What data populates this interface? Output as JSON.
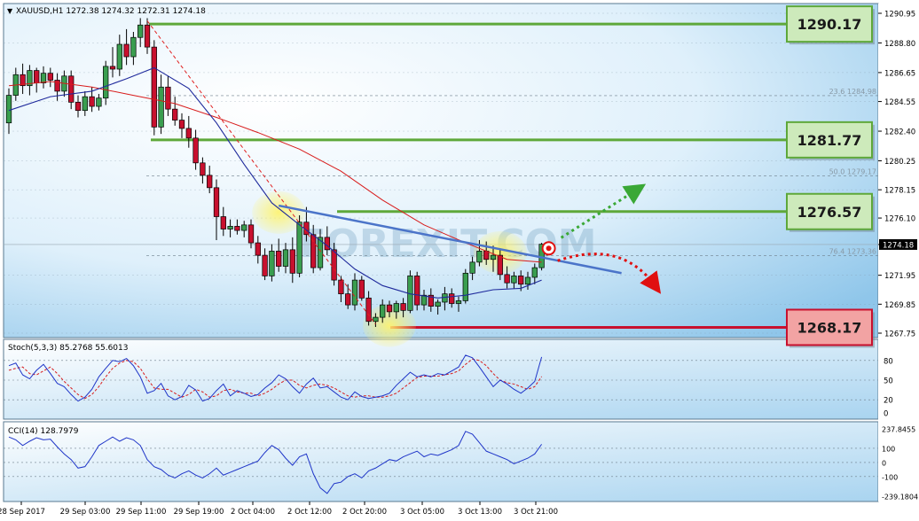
{
  "symbol_header": "XAUUSD,H1  1272.38 1274.32 1272.31 1274.18",
  "watermark": "FOREXIT.COM",
  "colors": {
    "bull_candle": "#3a9e4f",
    "bear_candle": "#c8102e",
    "ma_fast": "#1f2a9c",
    "ma_slow": "#d81b1b",
    "trendline": "#4b74c9",
    "level_green": "#5ea83a",
    "level_red": "#c8102e",
    "stoch_main": "#1f35c8",
    "stoch_signal": "#d81b1b",
    "cci": "#1f35c8"
  },
  "price_axis_ticks": [
    "1290.95",
    "1288.80",
    "1286.65",
    "1284.55",
    "1282.40",
    "1280.25",
    "1278.15",
    "1276.10",
    "1274.18",
    "1271.95",
    "1269.85",
    "1267.75"
  ],
  "current_price_label": "1274.18",
  "levels": [
    {
      "label": "1290.17",
      "price": 1290.17,
      "kind": "resistance"
    },
    {
      "label": "1281.77",
      "price": 1281.77,
      "kind": "resistance"
    },
    {
      "label": "1276.57",
      "price": 1276.57,
      "kind": "resistance"
    },
    {
      "label": "1268.17",
      "price": 1268.17,
      "kind": "support"
    }
  ],
  "fibo_labels": [
    {
      "label": "23.6  1284.98",
      "price": 1284.98
    },
    {
      "label": "50.0  1279.17",
      "price": 1279.17
    },
    {
      "label": "76.4  1273.36",
      "price": 1273.36
    }
  ],
  "time_axis_labels": [
    "28 Sep 2017",
    "29 Sep 03:00",
    "29 Sep 11:00",
    "29 Sep 19:00",
    "2 Oct 04:00",
    "2 Oct 12:00",
    "2 Oct 20:00",
    "3 Oct 05:00",
    "3 Oct 13:00",
    "3 Oct 21:00"
  ],
  "stoch": {
    "header": "Stoch(5,3,3) 85.2768 55.6013",
    "ticks": [
      "80",
      "50",
      "20",
      "0"
    ]
  },
  "cci": {
    "header": "CCI(14) 128.7979",
    "ticks": [
      "237.8455",
      "100",
      "0",
      "-100",
      "-239.1804"
    ]
  },
  "chart_data": {
    "type": "candlestick",
    "symbol": "XAUUSD",
    "timeframe": "H1",
    "ylim": [
      1267.2,
      1291.3
    ],
    "candles": [
      [
        1283.0,
        1285.5,
        1282.2,
        1285.0
      ],
      [
        1285.0,
        1287.0,
        1284.6,
        1286.5
      ],
      [
        1286.5,
        1287.3,
        1285.1,
        1285.7
      ],
      [
        1285.7,
        1287.2,
        1285.0,
        1286.8
      ],
      [
        1286.8,
        1287.0,
        1285.2,
        1285.9
      ],
      [
        1285.9,
        1287.1,
        1285.5,
        1286.6
      ],
      [
        1286.6,
        1287.0,
        1285.6,
        1286.1
      ],
      [
        1286.1,
        1286.6,
        1284.6,
        1285.3
      ],
      [
        1285.3,
        1286.8,
        1284.9,
        1286.4
      ],
      [
        1286.4,
        1286.8,
        1284.0,
        1284.5
      ],
      [
        1284.5,
        1285.0,
        1283.4,
        1283.9
      ],
      [
        1283.9,
        1285.3,
        1283.5,
        1284.9
      ],
      [
        1284.9,
        1285.6,
        1283.8,
        1284.2
      ],
      [
        1284.2,
        1285.1,
        1283.9,
        1284.8
      ],
      [
        1284.8,
        1287.5,
        1284.3,
        1287.1
      ],
      [
        1287.1,
        1288.5,
        1286.3,
        1286.9
      ],
      [
        1286.9,
        1289.4,
        1286.4,
        1288.7
      ],
      [
        1288.7,
        1289.8,
        1287.2,
        1287.8
      ],
      [
        1287.8,
        1289.6,
        1287.2,
        1289.2
      ],
      [
        1289.2,
        1290.6,
        1288.5,
        1290.1
      ],
      [
        1290.1,
        1290.6,
        1288.0,
        1288.5
      ],
      [
        1288.5,
        1289.0,
        1282.1,
        1282.7
      ],
      [
        1282.7,
        1286.5,
        1282.2,
        1285.6
      ],
      [
        1285.6,
        1286.4,
        1283.5,
        1284.0
      ],
      [
        1284.0,
        1284.9,
        1282.8,
        1283.2
      ],
      [
        1283.2,
        1283.7,
        1281.9,
        1282.6
      ],
      [
        1282.6,
        1283.5,
        1281.2,
        1281.9
      ],
      [
        1281.9,
        1282.5,
        1279.6,
        1280.1
      ],
      [
        1280.1,
        1280.5,
        1278.6,
        1279.2
      ],
      [
        1279.2,
        1279.9,
        1277.9,
        1278.3
      ],
      [
        1278.3,
        1278.9,
        1274.5,
        1276.2
      ],
      [
        1276.2,
        1276.9,
        1274.8,
        1275.3
      ],
      [
        1275.3,
        1276.0,
        1274.7,
        1275.5
      ],
      [
        1275.5,
        1276.0,
        1274.9,
        1275.2
      ],
      [
        1275.2,
        1275.9,
        1274.7,
        1275.6
      ],
      [
        1275.6,
        1276.0,
        1273.9,
        1274.3
      ],
      [
        1274.3,
        1274.8,
        1272.8,
        1273.4
      ],
      [
        1273.4,
        1273.9,
        1271.6,
        1271.9
      ],
      [
        1271.9,
        1274.2,
        1271.5,
        1273.7
      ],
      [
        1273.7,
        1274.6,
        1272.2,
        1272.6
      ],
      [
        1272.6,
        1274.3,
        1272.1,
        1273.8
      ],
      [
        1273.8,
        1274.7,
        1271.4,
        1272.1
      ],
      [
        1272.1,
        1276.3,
        1271.8,
        1275.8
      ],
      [
        1275.8,
        1276.9,
        1274.4,
        1274.9
      ],
      [
        1274.9,
        1275.6,
        1272.1,
        1272.5
      ],
      [
        1272.5,
        1275.3,
        1272.3,
        1274.7
      ],
      [
        1274.7,
        1275.5,
        1273.4,
        1273.8
      ],
      [
        1273.8,
        1274.3,
        1271.2,
        1271.6
      ],
      [
        1271.6,
        1271.9,
        1270.0,
        1270.6
      ],
      [
        1270.6,
        1271.3,
        1269.5,
        1269.8
      ],
      [
        1269.8,
        1272.1,
        1269.4,
        1271.6
      ],
      [
        1271.6,
        1271.9,
        1270.1,
        1270.3
      ],
      [
        1270.3,
        1270.8,
        1268.3,
        1268.6
      ],
      [
        1268.6,
        1269.2,
        1268.2,
        1268.9
      ],
      [
        1268.9,
        1270.2,
        1268.5,
        1269.8
      ],
      [
        1269.8,
        1270.1,
        1268.9,
        1269.3
      ],
      [
        1269.3,
        1270.1,
        1268.8,
        1269.9
      ],
      [
        1269.9,
        1270.3,
        1268.9,
        1269.4
      ],
      [
        1269.4,
        1272.3,
        1269.2,
        1271.9
      ],
      [
        1271.9,
        1272.2,
        1269.4,
        1269.8
      ],
      [
        1269.8,
        1270.9,
        1269.4,
        1270.5
      ],
      [
        1270.5,
        1271.0,
        1269.3,
        1269.7
      ],
      [
        1269.7,
        1270.2,
        1269.1,
        1270.0
      ],
      [
        1270.0,
        1271.1,
        1269.4,
        1270.6
      ],
      [
        1270.6,
        1271.0,
        1269.6,
        1269.9
      ],
      [
        1269.9,
        1270.4,
        1269.3,
        1270.1
      ],
      [
        1270.1,
        1272.4,
        1269.9,
        1272.1
      ],
      [
        1272.1,
        1273.3,
        1271.6,
        1272.9
      ],
      [
        1272.9,
        1274.5,
        1272.6,
        1273.7
      ],
      [
        1273.7,
        1274.4,
        1272.7,
        1273.1
      ],
      [
        1273.1,
        1274.1,
        1272.2,
        1273.4
      ],
      [
        1273.4,
        1273.9,
        1271.6,
        1272.0
      ],
      [
        1272.0,
        1272.6,
        1271.0,
        1271.4
      ],
      [
        1271.4,
        1272.2,
        1271.0,
        1271.9
      ],
      [
        1271.9,
        1272.3,
        1270.8,
        1271.3
      ],
      [
        1271.3,
        1272.2,
        1270.9,
        1271.8
      ],
      [
        1271.8,
        1272.8,
        1271.3,
        1272.5
      ],
      [
        1272.5,
        1274.3,
        1272.3,
        1274.2
      ]
    ],
    "ma_fast": [
      [
        0,
        1283.9
      ],
      [
        6,
        1284.9
      ],
      [
        12,
        1285.3
      ],
      [
        17,
        1286.2
      ],
      [
        21,
        1287.0
      ],
      [
        26,
        1285.5
      ],
      [
        30,
        1283.0
      ],
      [
        34,
        1280.0
      ],
      [
        38,
        1277.2
      ],
      [
        42,
        1275.6
      ],
      [
        46,
        1274.1
      ],
      [
        50,
        1272.4
      ],
      [
        54,
        1271.2
      ],
      [
        58,
        1270.6
      ],
      [
        62,
        1270.3
      ],
      [
        66,
        1270.5
      ],
      [
        70,
        1270.9
      ],
      [
        74,
        1271.0
      ],
      [
        77,
        1271.6
      ]
    ],
    "ma_slow": [
      [
        0,
        1285.7
      ],
      [
        6,
        1286.0
      ],
      [
        12,
        1285.6
      ],
      [
        18,
        1285.0
      ],
      [
        24,
        1284.4
      ],
      [
        30,
        1283.4
      ],
      [
        36,
        1282.3
      ],
      [
        42,
        1281.1
      ],
      [
        48,
        1279.5
      ],
      [
        54,
        1277.4
      ],
      [
        60,
        1275.6
      ],
      [
        66,
        1274.3
      ],
      [
        72,
        1273.1
      ],
      [
        77,
        1272.9
      ]
    ],
    "trendline": [
      [
        39,
        1277.0
      ],
      [
        77,
        1273.6
      ]
    ],
    "stoch_main": [
      72,
      76,
      58,
      52,
      65,
      74,
      60,
      45,
      40,
      28,
      18,
      24,
      36,
      55,
      68,
      80,
      78,
      83,
      72,
      55,
      30,
      34,
      45,
      26,
      20,
      25,
      42,
      35,
      18,
      22,
      34,
      44,
      26,
      34,
      30,
      25,
      28,
      38,
      46,
      58,
      52,
      40,
      30,
      44,
      53,
      38,
      40,
      32,
      24,
      20,
      32,
      25,
      22,
      24,
      26,
      30,
      42,
      52,
      62,
      55,
      58,
      55,
      60,
      58,
      64,
      70,
      88,
      84,
      70,
      55,
      40,
      50,
      44,
      36,
      30,
      38,
      48,
      85.3
    ],
    "stoch_signal": [
      65,
      68,
      70,
      60,
      58,
      64,
      70,
      60,
      48,
      38,
      28,
      22,
      28,
      40,
      55,
      68,
      76,
      80,
      78,
      68,
      52,
      38,
      36,
      36,
      30,
      24,
      28,
      36,
      32,
      24,
      26,
      34,
      36,
      32,
      30,
      30,
      26,
      30,
      36,
      44,
      50,
      50,
      42,
      38,
      42,
      44,
      42,
      38,
      32,
      26,
      24,
      26,
      26,
      24,
      24,
      26,
      30,
      38,
      46,
      54,
      56,
      56,
      56,
      58,
      60,
      64,
      74,
      82,
      80,
      72,
      60,
      50,
      46,
      44,
      40,
      36,
      40,
      55.6
    ],
    "cci": [
      180,
      160,
      120,
      150,
      175,
      160,
      165,
      110,
      60,
      20,
      -40,
      -30,
      40,
      120,
      150,
      180,
      150,
      175,
      160,
      120,
      20,
      -30,
      -50,
      -90,
      -110,
      -80,
      -60,
      -90,
      -110,
      -80,
      -40,
      -90,
      -70,
      -50,
      -30,
      -10,
      10,
      70,
      120,
      90,
      30,
      -20,
      40,
      60,
      -80,
      -180,
      -220,
      -150,
      -140,
      -100,
      -80,
      -110,
      -60,
      -40,
      -10,
      20,
      10,
      40,
      60,
      80,
      40,
      60,
      50,
      70,
      90,
      120,
      220,
      200,
      140,
      80,
      60,
      40,
      20,
      -10,
      10,
      30,
      60,
      128.8
    ]
  }
}
